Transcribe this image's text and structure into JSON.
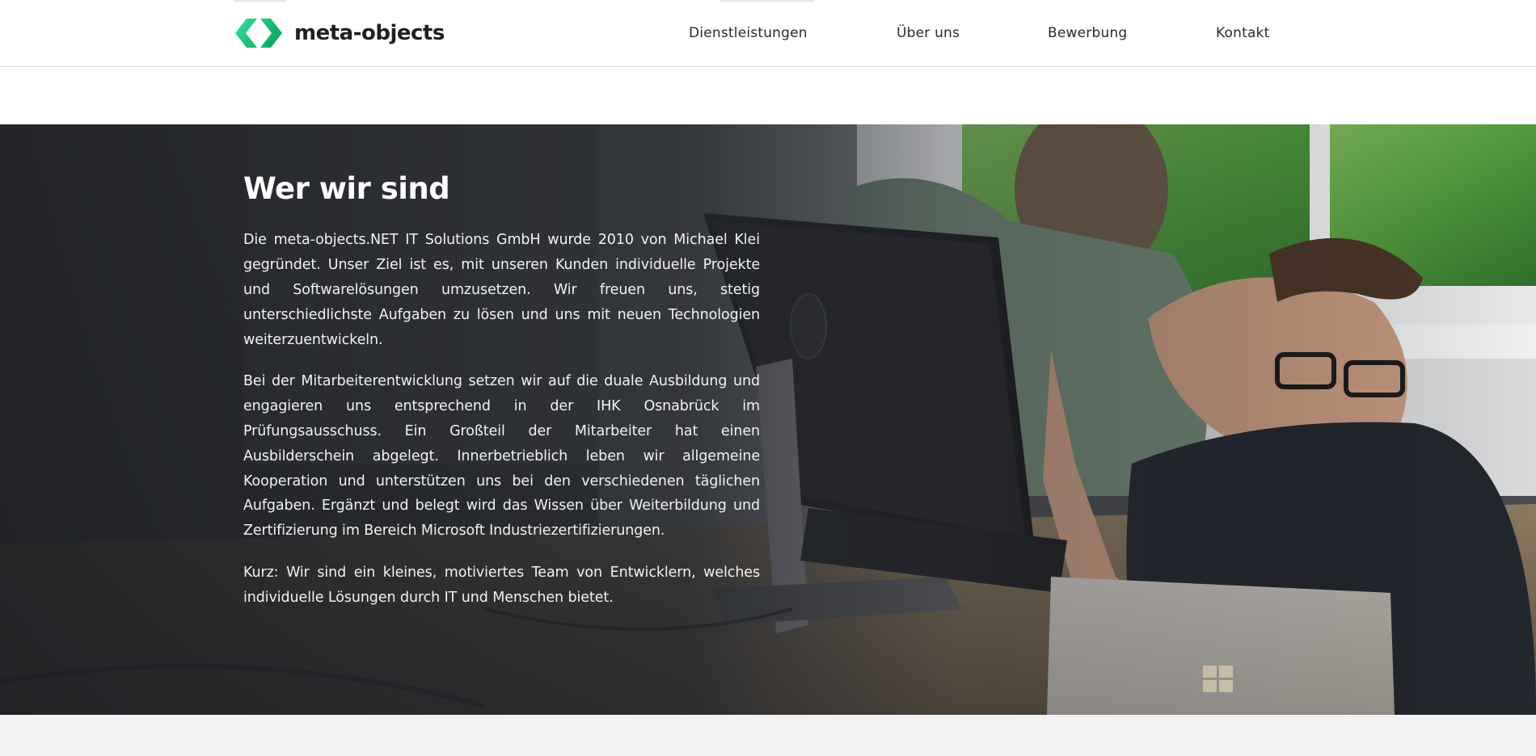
{
  "brand": {
    "name": "meta-objects",
    "colors": {
      "logo_green_light": "#2ee08f",
      "logo_green_dark": "#10b26d",
      "text_dark": "#1f1f1f",
      "hero_overlay": "#1f2126",
      "footer_band": "#f2f2f2"
    }
  },
  "nav": {
    "items": [
      {
        "label": "Dienstleistungen"
      },
      {
        "label": "Über uns"
      },
      {
        "label": "Bewerbung"
      },
      {
        "label": "Kontakt"
      }
    ]
  },
  "hero": {
    "title": "Wer wir sind",
    "paragraphs": [
      "Die meta-objects.NET IT Solutions GmbH wurde 2010 von Michael Klei gegründet. Unser Ziel ist es, mit unseren Kunden individuelle Projekte und Softwarelösungen umzusetzen. Wir freuen uns, stetig unterschiedlichste Aufgaben zu lösen und uns mit neuen Technologien weiterzuentwickeln.",
      "Bei der Mitarbeiterentwicklung setzen wir auf die duale Ausbildung und engagieren uns entsprechend in der IHK Osnabrück im Prüfungsausschuss. Ein Großteil der Mitarbeiter hat einen Ausbilderschein abgelegt. Innerbetrieblich leben wir allgemeine Kooperation und unterstützen uns bei den verschiedenen täglichen Aufgaben. Ergänzt und belegt wird das Wissen über Weiterbildung und Zertifizierung im Bereich Microsoft Industriezertifizierungen.",
      "Kurz: Wir sind ein kleines, motiviertes Team von Entwicklern, welches individuelle Lösungen durch IT und Menschen bietet."
    ],
    "image_icons": [
      "dell-logo-icon",
      "windows-logo-icon"
    ]
  }
}
